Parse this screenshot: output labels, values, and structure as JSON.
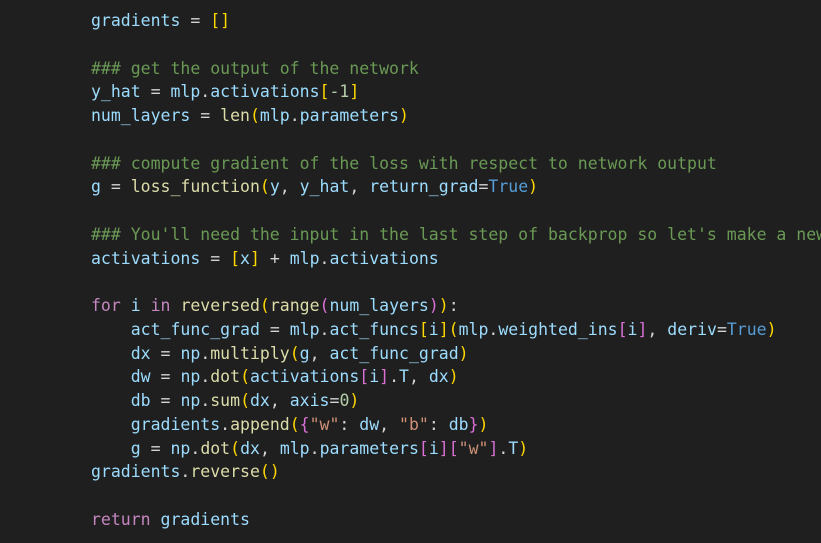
{
  "editor": {
    "background": "#1f1f1f",
    "colors": {
      "keyword": "#c586c0",
      "function": "#dcdcaa",
      "variable": "#9cdcfe",
      "string": "#ce9178",
      "number": "#b5cea8",
      "boolean": "#569cd6",
      "comment": "#6a9955",
      "bracket_level_1": "#ffd700",
      "bracket_level_2": "#da70d6",
      "bracket_level_3": "#179fff"
    },
    "lines": [
      {
        "text": "gradients = []",
        "tokens": [
          [
            "var",
            "gradients"
          ],
          [
            "op",
            " = "
          ],
          [
            "br1",
            "[]"
          ]
        ]
      },
      {
        "text": "",
        "tokens": []
      },
      {
        "text": "### get the output of the network",
        "tokens": [
          [
            "cmt",
            "### get the output of the network"
          ]
        ]
      },
      {
        "text": "y_hat = mlp.activations[-1]",
        "tokens": [
          [
            "var",
            "y_hat"
          ],
          [
            "op",
            " = "
          ],
          [
            "var",
            "mlp"
          ],
          [
            "op",
            "."
          ],
          [
            "var",
            "activations"
          ],
          [
            "br1",
            "["
          ],
          [
            "num",
            "-1"
          ],
          [
            "br1",
            "]"
          ]
        ]
      },
      {
        "text": "num_layers = len(mlp.parameters)",
        "tokens": [
          [
            "var",
            "num_layers"
          ],
          [
            "op",
            " = "
          ],
          [
            "fn",
            "len"
          ],
          [
            "br1",
            "("
          ],
          [
            "var",
            "mlp"
          ],
          [
            "op",
            "."
          ],
          [
            "var",
            "parameters"
          ],
          [
            "br1",
            ")"
          ]
        ]
      },
      {
        "text": "",
        "tokens": []
      },
      {
        "text": "### compute gradient of the loss with respect to network output",
        "tokens": [
          [
            "cmt",
            "### compute gradient of the loss with respect to network output"
          ]
        ]
      },
      {
        "text": "g = loss_function(y, y_hat, return_grad=True)",
        "tokens": [
          [
            "var",
            "g"
          ],
          [
            "op",
            " = "
          ],
          [
            "fn",
            "loss_function"
          ],
          [
            "br1",
            "("
          ],
          [
            "var",
            "y"
          ],
          [
            "op",
            ", "
          ],
          [
            "var",
            "y_hat"
          ],
          [
            "op",
            ", "
          ],
          [
            "var",
            "return_grad"
          ],
          [
            "op",
            "="
          ],
          [
            "bool",
            "True"
          ],
          [
            "br1",
            ")"
          ]
        ]
      },
      {
        "text": "",
        "tokens": []
      },
      {
        "text": "### You'll need the input in the last step of backprop so let's make a new l",
        "tokens": [
          [
            "cmt",
            "### You'll need the input in the last step of backprop so let's make a new l"
          ]
        ]
      },
      {
        "text": "activations = [x] + mlp.activations",
        "tokens": [
          [
            "var",
            "activations"
          ],
          [
            "op",
            " = "
          ],
          [
            "br1",
            "["
          ],
          [
            "var",
            "x"
          ],
          [
            "br1",
            "]"
          ],
          [
            "op",
            " + "
          ],
          [
            "var",
            "mlp"
          ],
          [
            "op",
            "."
          ],
          [
            "var",
            "activations"
          ]
        ]
      },
      {
        "text": "",
        "tokens": []
      },
      {
        "text": "for i in reversed(range(num_layers)):",
        "tokens": [
          [
            "kw",
            "for"
          ],
          [
            "op",
            " "
          ],
          [
            "var",
            "i"
          ],
          [
            "op",
            " "
          ],
          [
            "kw",
            "in"
          ],
          [
            "op",
            " "
          ],
          [
            "fn",
            "reversed"
          ],
          [
            "br1",
            "("
          ],
          [
            "fn",
            "range"
          ],
          [
            "br2",
            "("
          ],
          [
            "var",
            "num_layers"
          ],
          [
            "br2",
            ")"
          ],
          [
            "br1",
            ")"
          ],
          [
            "op",
            ":"
          ]
        ]
      },
      {
        "text": "    act_func_grad = mlp.act_funcs[i](mlp.weighted_ins[i], deriv=True)",
        "tokens": [
          [
            "op",
            "    "
          ],
          [
            "var",
            "act_func_grad"
          ],
          [
            "op",
            " = "
          ],
          [
            "var",
            "mlp"
          ],
          [
            "op",
            "."
          ],
          [
            "var",
            "act_funcs"
          ],
          [
            "br1",
            "["
          ],
          [
            "var",
            "i"
          ],
          [
            "br1",
            "]"
          ],
          [
            "br1",
            "("
          ],
          [
            "var",
            "mlp"
          ],
          [
            "op",
            "."
          ],
          [
            "var",
            "weighted_ins"
          ],
          [
            "br2",
            "["
          ],
          [
            "var",
            "i"
          ],
          [
            "br2",
            "]"
          ],
          [
            "op",
            ", "
          ],
          [
            "var",
            "deriv"
          ],
          [
            "op",
            "="
          ],
          [
            "bool",
            "True"
          ],
          [
            "br1",
            ")"
          ]
        ]
      },
      {
        "text": "    dx = np.multiply(g, act_func_grad)",
        "tokens": [
          [
            "op",
            "    "
          ],
          [
            "var",
            "dx"
          ],
          [
            "op",
            " = "
          ],
          [
            "var",
            "np"
          ],
          [
            "op",
            "."
          ],
          [
            "fn",
            "multiply"
          ],
          [
            "br1",
            "("
          ],
          [
            "var",
            "g"
          ],
          [
            "op",
            ", "
          ],
          [
            "var",
            "act_func_grad"
          ],
          [
            "br1",
            ")"
          ]
        ]
      },
      {
        "text": "    dw = np.dot(activations[i].T, dx)",
        "tokens": [
          [
            "op",
            "    "
          ],
          [
            "var",
            "dw"
          ],
          [
            "op",
            " = "
          ],
          [
            "var",
            "np"
          ],
          [
            "op",
            "."
          ],
          [
            "fn",
            "dot"
          ],
          [
            "br1",
            "("
          ],
          [
            "var",
            "activations"
          ],
          [
            "br2",
            "["
          ],
          [
            "var",
            "i"
          ],
          [
            "br2",
            "]"
          ],
          [
            "op",
            "."
          ],
          [
            "var",
            "T"
          ],
          [
            "op",
            ", "
          ],
          [
            "var",
            "dx"
          ],
          [
            "br1",
            ")"
          ]
        ]
      },
      {
        "text": "    db = np.sum(dx, axis=0)",
        "tokens": [
          [
            "op",
            "    "
          ],
          [
            "var",
            "db"
          ],
          [
            "op",
            " = "
          ],
          [
            "var",
            "np"
          ],
          [
            "op",
            "."
          ],
          [
            "fn",
            "sum"
          ],
          [
            "br1",
            "("
          ],
          [
            "var",
            "dx"
          ],
          [
            "op",
            ", "
          ],
          [
            "var",
            "axis"
          ],
          [
            "op",
            "="
          ],
          [
            "num",
            "0"
          ],
          [
            "br1",
            ")"
          ]
        ]
      },
      {
        "text": "    gradients.append({\"w\": dw, \"b\": db})",
        "tokens": [
          [
            "op",
            "    "
          ],
          [
            "var",
            "gradients"
          ],
          [
            "op",
            "."
          ],
          [
            "fn",
            "append"
          ],
          [
            "br1",
            "("
          ],
          [
            "br2",
            "{"
          ],
          [
            "str",
            "\"w\""
          ],
          [
            "op",
            ": "
          ],
          [
            "var",
            "dw"
          ],
          [
            "op",
            ", "
          ],
          [
            "str",
            "\"b\""
          ],
          [
            "op",
            ": "
          ],
          [
            "var",
            "db"
          ],
          [
            "br2",
            "}"
          ],
          [
            "br1",
            ")"
          ]
        ]
      },
      {
        "text": "    g = np.dot(dx, mlp.parameters[i][\"w\"].T)",
        "tokens": [
          [
            "op",
            "    "
          ],
          [
            "var",
            "g"
          ],
          [
            "op",
            " = "
          ],
          [
            "var",
            "np"
          ],
          [
            "op",
            "."
          ],
          [
            "fn",
            "dot"
          ],
          [
            "br1",
            "("
          ],
          [
            "var",
            "dx"
          ],
          [
            "op",
            ", "
          ],
          [
            "var",
            "mlp"
          ],
          [
            "op",
            "."
          ],
          [
            "var",
            "parameters"
          ],
          [
            "br2",
            "["
          ],
          [
            "var",
            "i"
          ],
          [
            "br2",
            "]"
          ],
          [
            "br2",
            "["
          ],
          [
            "str",
            "\"w\""
          ],
          [
            "br2",
            "]"
          ],
          [
            "op",
            "."
          ],
          [
            "var",
            "T"
          ],
          [
            "br1",
            ")"
          ]
        ]
      },
      {
        "text": "gradients.reverse()",
        "tokens": [
          [
            "var",
            "gradients"
          ],
          [
            "op",
            "."
          ],
          [
            "fn",
            "reverse"
          ],
          [
            "br1",
            "()"
          ]
        ]
      },
      {
        "text": "",
        "tokens": []
      },
      {
        "text": "return gradients",
        "tokens": [
          [
            "kw",
            "return"
          ],
          [
            "op",
            " "
          ],
          [
            "var",
            "gradients"
          ]
        ]
      }
    ]
  }
}
